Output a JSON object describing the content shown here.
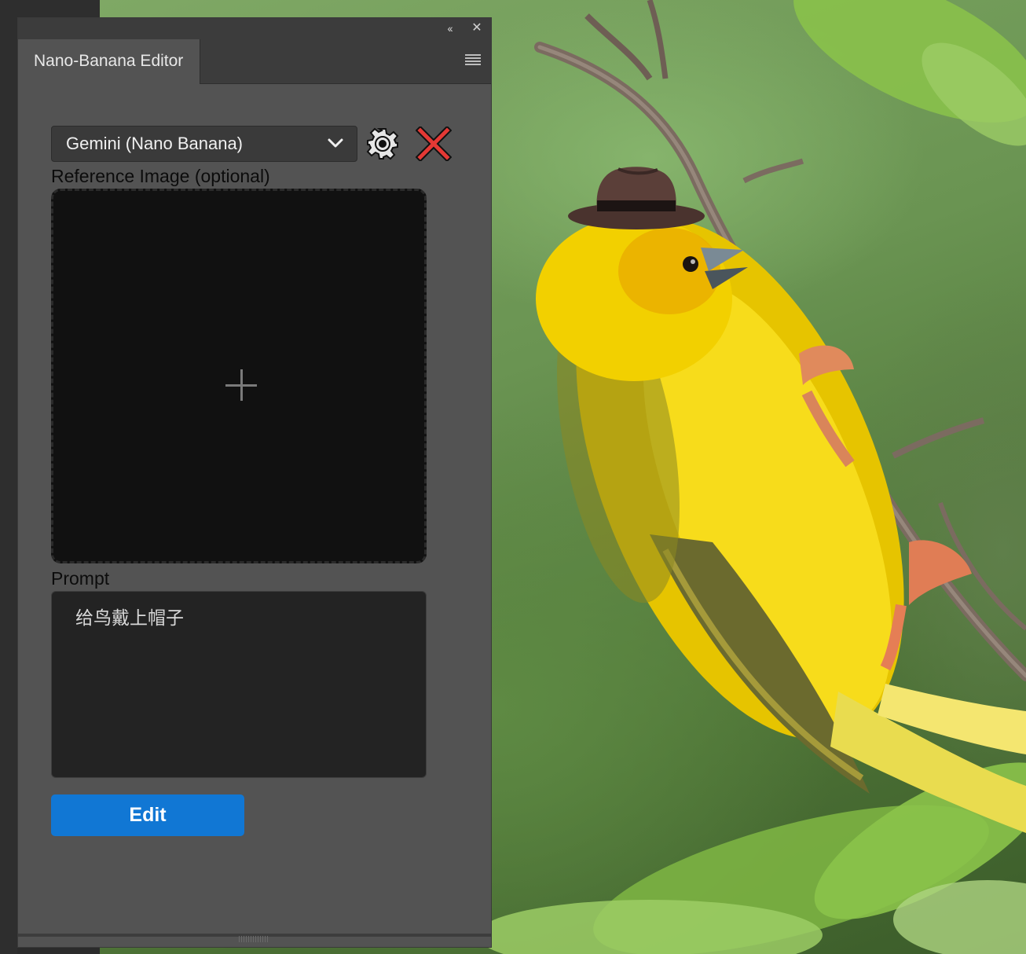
{
  "panel": {
    "tab_title": "Nano-Banana Editor",
    "collapse_glyph": "‹‹",
    "close_glyph": "✕"
  },
  "model": {
    "selected": "Gemini (Nano Banana)"
  },
  "reference": {
    "label": "Reference Image (optional)",
    "add_icon": "plus-icon"
  },
  "prompt": {
    "label": "Prompt",
    "value": "给鸟戴上帽子"
  },
  "actions": {
    "edit_label": "Edit"
  },
  "colors": {
    "panel_bg": "#535353",
    "accent": "#1177d4",
    "clear_red": "#e53935"
  },
  "canvas": {
    "subject": "yellow-bird-with-hat-photo"
  }
}
